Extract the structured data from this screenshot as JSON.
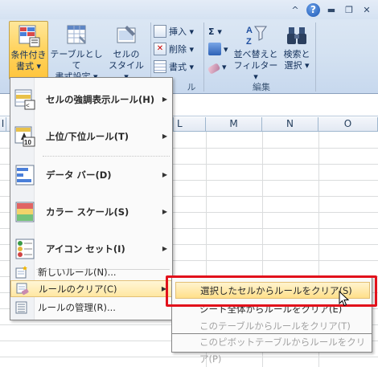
{
  "ribbon": {
    "buttons": {
      "conditional_format": [
        "条件付き",
        "書式 ▾"
      ],
      "format_as_table": [
        "テーブルとして",
        "書式設定 ▾"
      ],
      "cell_styles": [
        "セルの",
        "スタイル ▾"
      ],
      "insert": "挿入 ▾",
      "delete": "削除 ▾",
      "format": "書式 ▾",
      "sum": "Σ ▾",
      "sort_filter": [
        "並べ替えと",
        "フィルター ▾"
      ],
      "find_select": [
        "検索と",
        "選択 ▾"
      ]
    },
    "group_labels": {
      "cells": "ル",
      "editing": "編集"
    }
  },
  "columns": [
    "L",
    "M",
    "N",
    "O"
  ],
  "row_header_hint": "I",
  "menu": {
    "items": [
      {
        "label": "セルの強調表示ルール(H)",
        "icon": "highlight-rules-icon"
      },
      {
        "label": "上位/下位ルール(T)",
        "icon": "top-bottom-icon"
      },
      {
        "label": "データ バー(D)",
        "icon": "data-bars-icon"
      },
      {
        "label": "カラー スケール(S)",
        "icon": "color-scale-icon"
      },
      {
        "label": "アイコン セット(I)",
        "icon": "icon-sets-icon"
      }
    ],
    "small_items": [
      {
        "label": "新しいルール(N)...",
        "icon": "new-rule-icon"
      },
      {
        "label": "ルールのクリア(C)",
        "icon": "clear-rules-icon"
      },
      {
        "label": "ルールの管理(R)...",
        "icon": "manage-rules-icon"
      }
    ]
  },
  "submenu": {
    "items": [
      {
        "label": "選択したセルからルールをクリア(S)",
        "state": "highlighted"
      },
      {
        "label": "シート全体からルールをクリア(E)",
        "state": "enabled"
      },
      {
        "label": "このテーブルからルールをクリア(T)",
        "state": "disabled"
      },
      {
        "label": "このピボットテーブルからルールをクリア(P)",
        "state": "disabled"
      }
    ]
  },
  "colors": {
    "highlight_border": "#e2111b",
    "hover_fill": "#ffe7a2"
  }
}
